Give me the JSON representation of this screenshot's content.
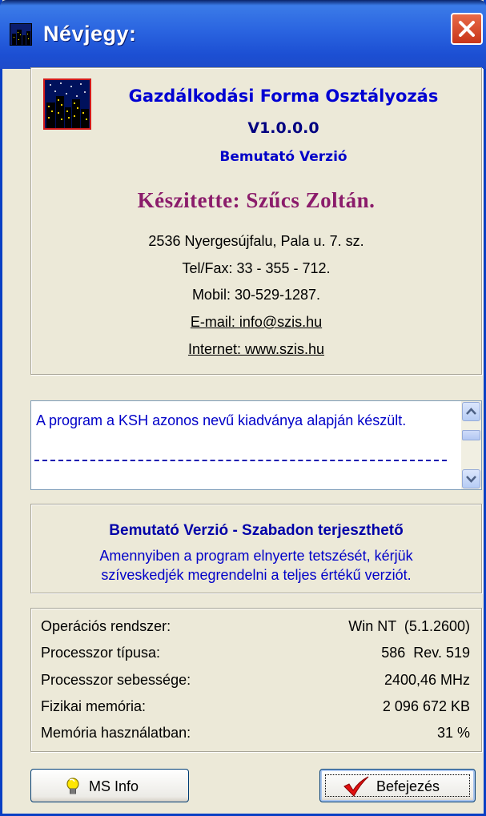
{
  "window": {
    "title": "Névjegy:"
  },
  "about": {
    "product": "Gazdálkodási Forma Osztályozás",
    "version": "V1.0.0.0",
    "edition": "Bemutató Verzió",
    "author": "Készitette: Szűcs Zoltán.",
    "address": "2536 Nyergesújfalu, Pala u. 7. sz.",
    "phone": "Tel/Fax: 33 - 355 - 712.",
    "mobile": "Mobil: 30-529-1287.",
    "email": "E-mail: info@szis.hu",
    "internet": "Internet: www.szis.hu"
  },
  "notes": {
    "text": "A program a KSH azonos nevű kiadványa alapján készült."
  },
  "demo_notice": {
    "title": "Bemutató Verzió - Szabadon terjeszthető",
    "line1": "Amennyiben a program elnyerte tetszését, kérjük",
    "line2": "szíveskedjék megrendelni a teljes értékű verziót."
  },
  "system": [
    {
      "label": "Operációs rendszer:",
      "value": "Win NT  (5.1.2600)"
    },
    {
      "label": "Processzor típusa:",
      "value": "586  Rev. 519"
    },
    {
      "label": "Processzor sebessége:",
      "value": "2400,46 MHz"
    },
    {
      "label": "Fizikai memória:",
      "value": "2 096 672 KB"
    },
    {
      "label": "Memória használatban:",
      "value": "31 %"
    }
  ],
  "buttons": {
    "msinfo": "MS Info",
    "finish": "Befejezés"
  },
  "icons": {
    "msinfo": "lightbulb-icon",
    "finish": "checkmark-icon",
    "close": "close-icon",
    "app": "night-city-icon"
  },
  "colors": {
    "title_bar": "#2a64e0",
    "accent": "#0000c8",
    "author": "#8b1c6b"
  }
}
